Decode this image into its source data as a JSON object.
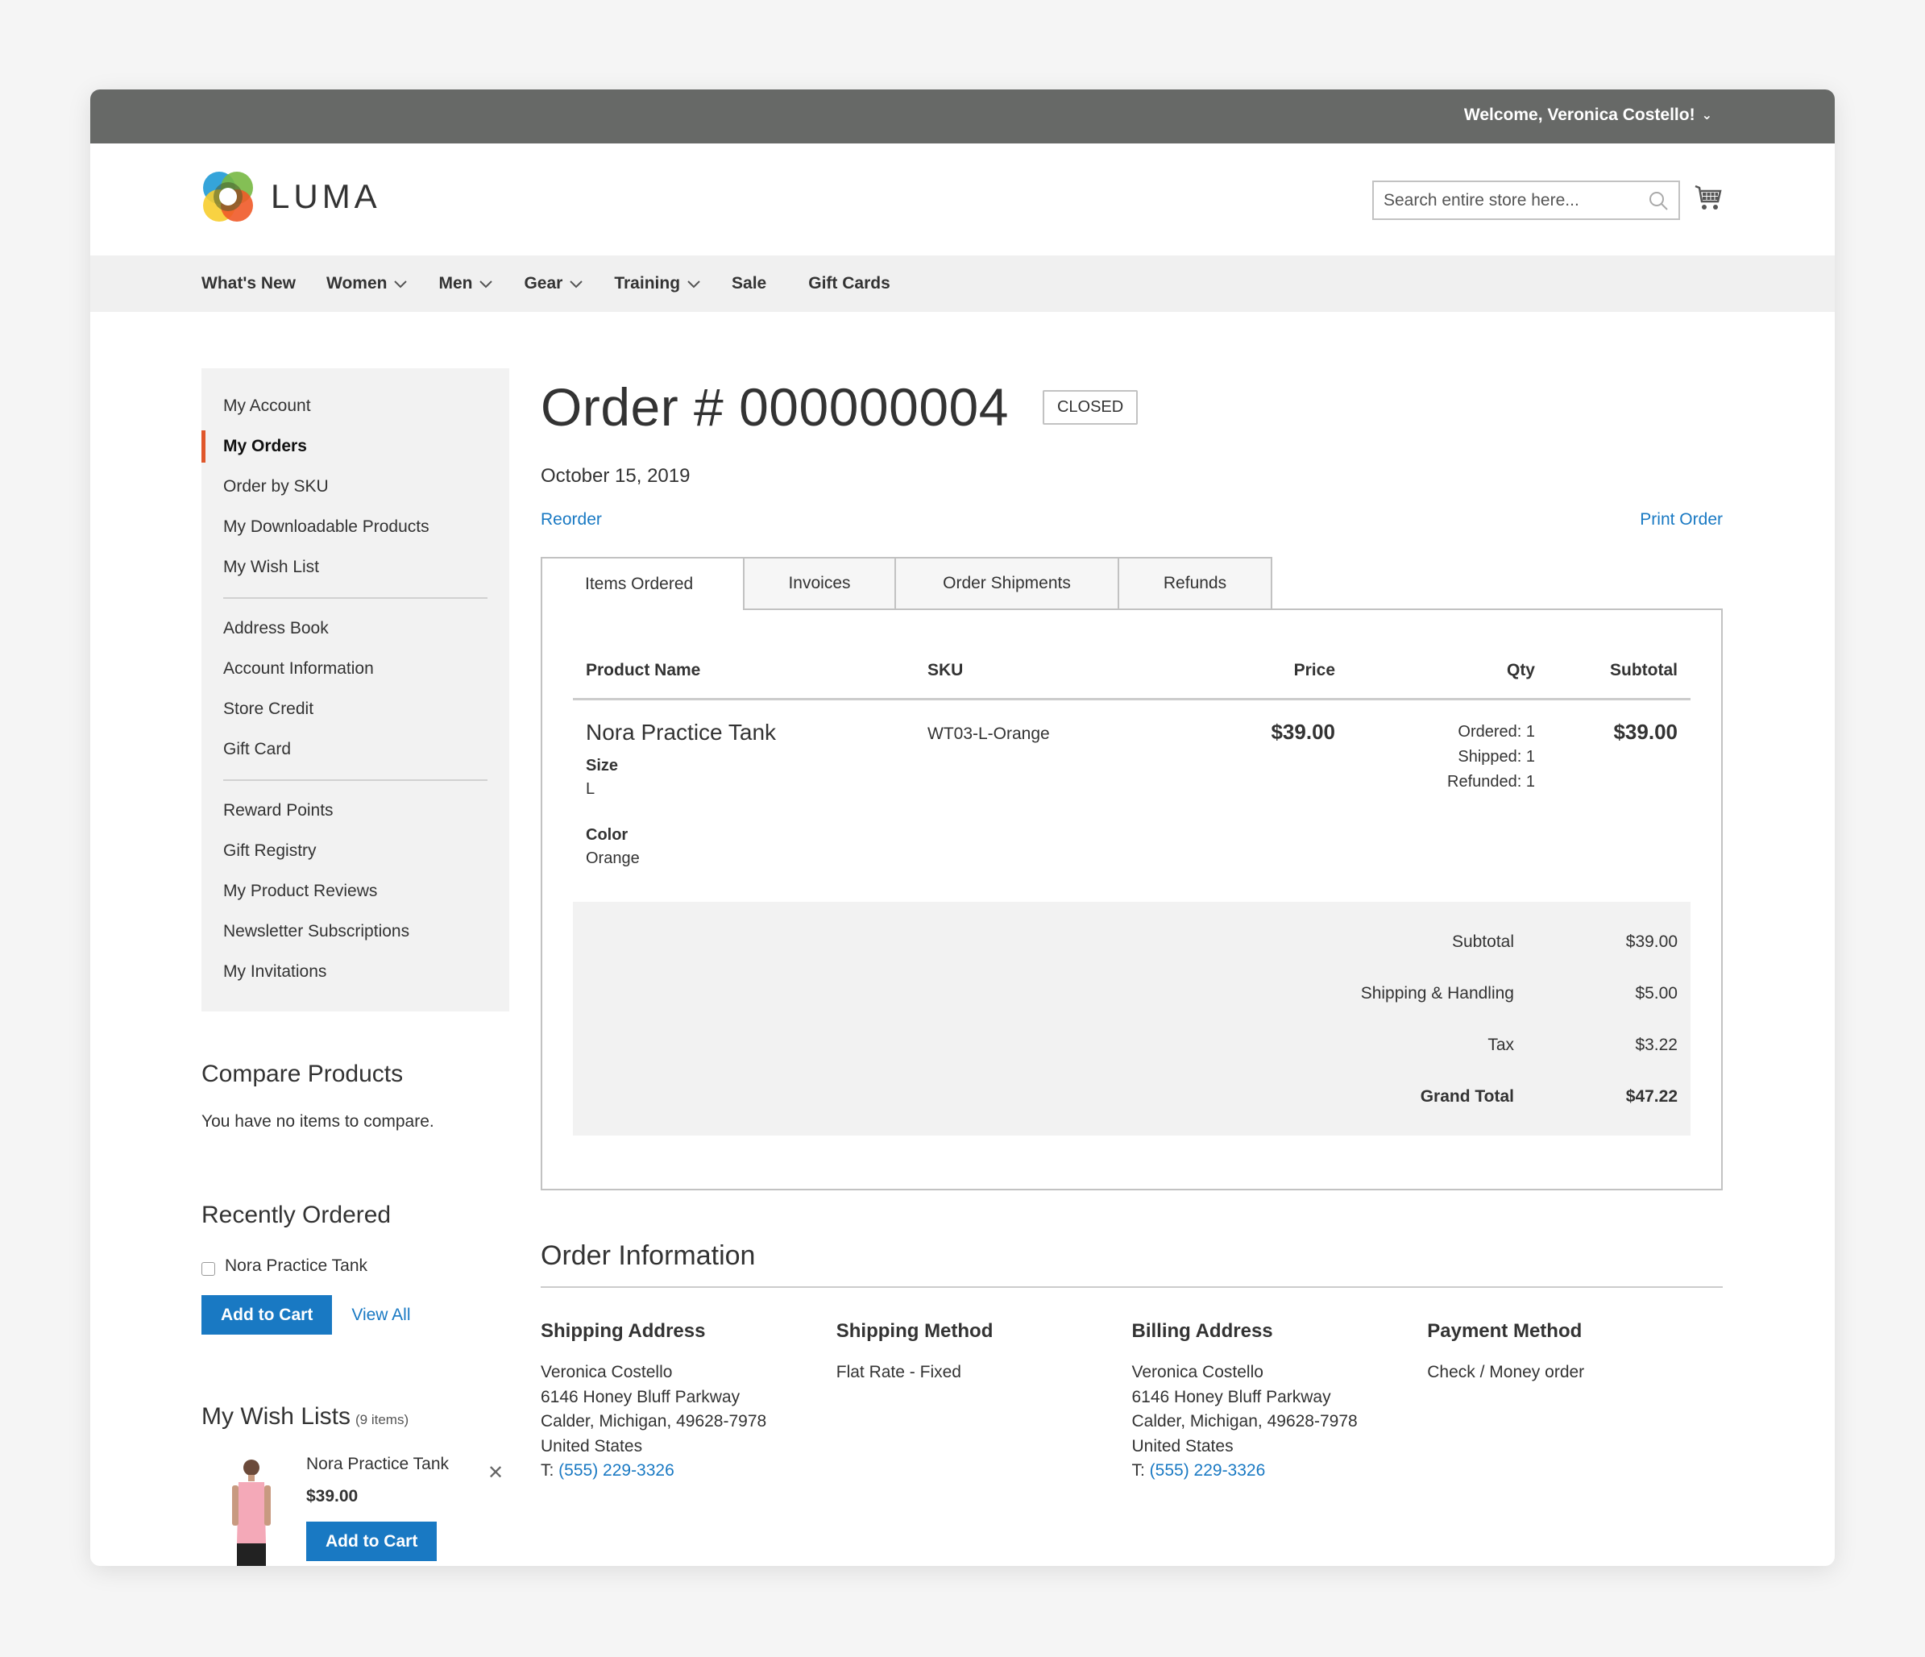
{
  "topbar": {
    "welcome": "Welcome, Veronica Costello!"
  },
  "header": {
    "logo_text": "LUMA",
    "search": {
      "placeholder": "Search entire store here..."
    },
    "icons": {
      "search": "search-icon",
      "cart": "cart-icon"
    }
  },
  "nav": {
    "items": [
      {
        "label": "What's New",
        "has_dropdown": false
      },
      {
        "label": "Women",
        "has_dropdown": true
      },
      {
        "label": "Men",
        "has_dropdown": true
      },
      {
        "label": "Gear",
        "has_dropdown": true
      },
      {
        "label": "Training",
        "has_dropdown": true
      },
      {
        "label": "Sale",
        "has_dropdown": false
      },
      {
        "label": "Gift Cards",
        "has_dropdown": false
      }
    ]
  },
  "sidebar": {
    "groups": [
      [
        "My Account",
        "My Orders",
        "Order by SKU",
        "My Downloadable Products",
        "My Wish List"
      ],
      [
        "Address Book",
        "Account Information",
        "Store Credit",
        "Gift Card"
      ],
      [
        "Reward Points",
        "Gift Registry",
        "My Product Reviews",
        "Newsletter Subscriptions",
        "My Invitations"
      ]
    ],
    "active": "My Orders",
    "accent_color": "#e0572b"
  },
  "compare": {
    "title": "Compare Products",
    "empty_text": "You have no items to compare."
  },
  "recently_ordered": {
    "title": "Recently Ordered",
    "items": [
      "Nora Practice Tank"
    ],
    "add_to_cart": "Add to Cart",
    "view_all": "View All"
  },
  "wishlist": {
    "title": "My Wish Lists",
    "count": "(9 items)",
    "item": {
      "name": "Nora Practice Tank",
      "price": "$39.00",
      "add_to_cart": "Add to Cart"
    }
  },
  "order": {
    "title": "Order # 000000004",
    "status": "CLOSED",
    "date": "October 15, 2019",
    "reorder": "Reorder",
    "print": "Print Order",
    "tabs": [
      "Items Ordered",
      "Invoices",
      "Order Shipments",
      "Refunds"
    ],
    "active_tab": "Items Ordered",
    "columns": {
      "name": "Product Name",
      "sku": "SKU",
      "price": "Price",
      "qty": "Qty",
      "subtotal": "Subtotal"
    },
    "items": [
      {
        "name": "Nora Practice Tank",
        "options": [
          {
            "label": "Size",
            "value": "L"
          },
          {
            "label": "Color",
            "value": "Orange"
          }
        ],
        "sku": "WT03-L-Orange",
        "price": "$39.00",
        "qty": [
          "Ordered: 1",
          "Shipped: 1",
          "Refunded: 1"
        ],
        "subtotal": "$39.00"
      }
    ],
    "totals": [
      {
        "label": "Subtotal",
        "value": "$39.00"
      },
      {
        "label": "Shipping & Handling",
        "value": "$5.00"
      },
      {
        "label": "Tax",
        "value": "$3.22"
      },
      {
        "label": "Grand Total",
        "value": "$47.22"
      }
    ]
  },
  "order_info": {
    "title": "Order Information",
    "shipping_address": {
      "heading": "Shipping Address",
      "lines": [
        "Veronica Costello",
        "6146 Honey Bluff Parkway",
        "Calder, Michigan, 49628-7978",
        "United States"
      ],
      "phone_prefix": "T: ",
      "phone": "(555) 229-3326"
    },
    "shipping_method": {
      "heading": "Shipping Method",
      "value": "Flat Rate - Fixed"
    },
    "billing_address": {
      "heading": "Billing Address",
      "lines": [
        "Veronica Costello",
        "6146 Honey Bluff Parkway",
        "Calder, Michigan, 49628-7978",
        "United States"
      ],
      "phone_prefix": "T: ",
      "phone": "(555) 229-3326"
    },
    "payment_method": {
      "heading": "Payment Method",
      "value": "Check / Money order"
    }
  },
  "colors": {
    "link": "#1979c3",
    "topbar": "#676967",
    "nav_bg": "#f0f0f0",
    "button": "#1979c3"
  }
}
